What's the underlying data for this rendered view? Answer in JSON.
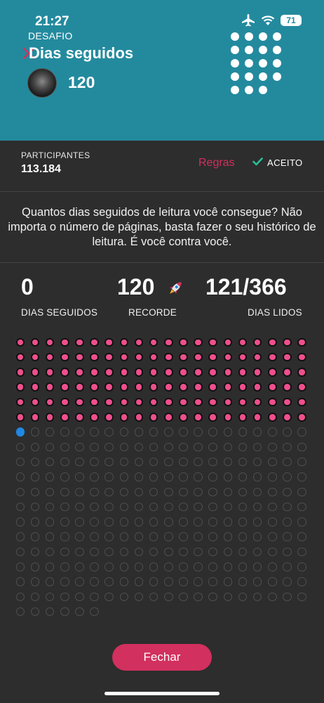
{
  "status_bar": {
    "time": "21:27",
    "battery": "71",
    "icons": [
      "airplane-icon",
      "wifi-icon",
      "battery-icon"
    ]
  },
  "header": {
    "label": "DESAFIO",
    "title": "Dias seguidos",
    "count": "120",
    "icons": [
      "close-icon",
      "avatar",
      "logo-dots-icon"
    ]
  },
  "participants": {
    "label": "PARTICIPANTES",
    "value": "113.184",
    "rules_label": "Regras",
    "accepted_label": "ACEITO",
    "accepted_icon": "checkmark-icon"
  },
  "description": "Quantos dias seguidos de leitura você consegue? Não importa o número de páginas, basta fazer o seu histórico de leitura. É você contra você.",
  "stats": {
    "streak": {
      "value": "0",
      "label": "DIAS SEGUIDOS"
    },
    "record": {
      "value": "120",
      "label": "RECORDE",
      "icon": "rocket-icon"
    },
    "days_read": {
      "value": "121/366",
      "label": "DIAS LIDOS"
    }
  },
  "calendar": {
    "total_days": 366,
    "read_days": 121,
    "streak_days": 120,
    "today_index": 120
  },
  "footer": {
    "close_button": "Fechar"
  },
  "colors": {
    "header_bg": "#238a9e",
    "background": "#2d2d2d",
    "accent_pink": "#d2305e",
    "dot_blue": "#1e88e5",
    "dot_pink": "#ee4f8d",
    "check_green": "#2bbf9a"
  }
}
